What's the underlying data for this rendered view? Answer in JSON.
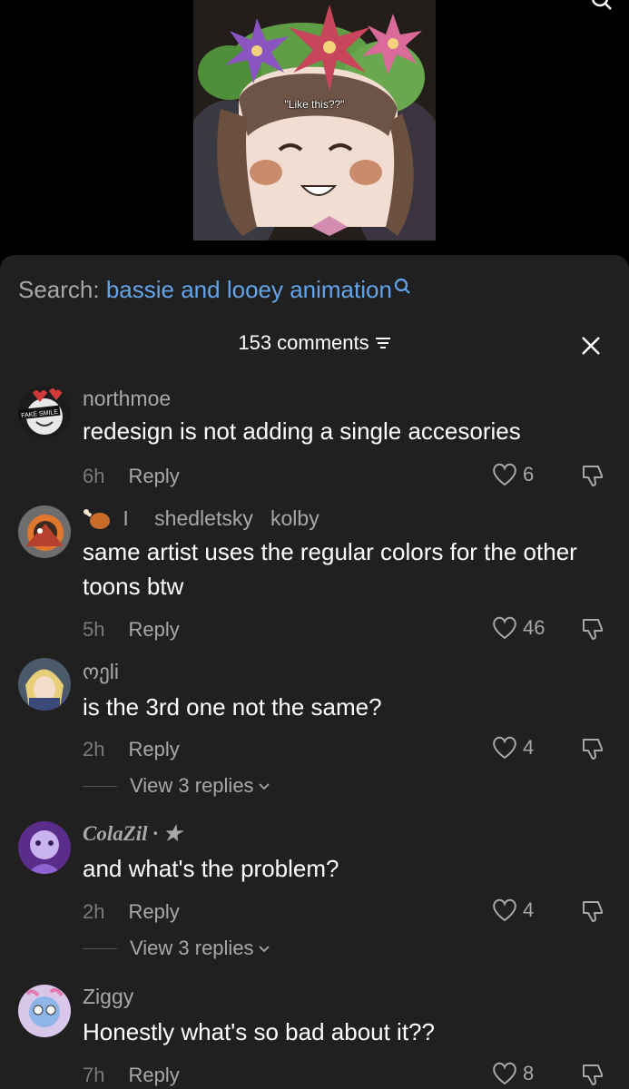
{
  "video": {
    "caption": "\"Like this??\""
  },
  "search": {
    "label": "Search:",
    "term": "bassie and looey animation"
  },
  "header": {
    "count_label": "153 comments"
  },
  "comments": [
    {
      "user": "northmoe",
      "text": "redesign is not adding a single accesories",
      "time": "6h",
      "reply": "Reply",
      "likes": "6",
      "avatar_text": "FAKE SMILE"
    },
    {
      "user_prefix": "I",
      "user": "shedletsky   kolby",
      "text": "same artist uses the regular colors for the other toons btw",
      "time": "5h",
      "reply": "Reply",
      "likes": "46"
    },
    {
      "user": "ოეli",
      "text": "is the 3rd one not the same?",
      "time": "2h",
      "reply": "Reply",
      "likes": "4",
      "view_replies": "View 3 replies"
    },
    {
      "user": "ColaZil · ★",
      "text": "and what's the problem?",
      "time": "2h",
      "reply": "Reply",
      "likes": "4",
      "view_replies": "View 3 replies"
    },
    {
      "user": "Ziggy",
      "text": "Honestly what's so bad about it??",
      "time": "7h",
      "reply": "Reply",
      "likes": "8"
    }
  ]
}
